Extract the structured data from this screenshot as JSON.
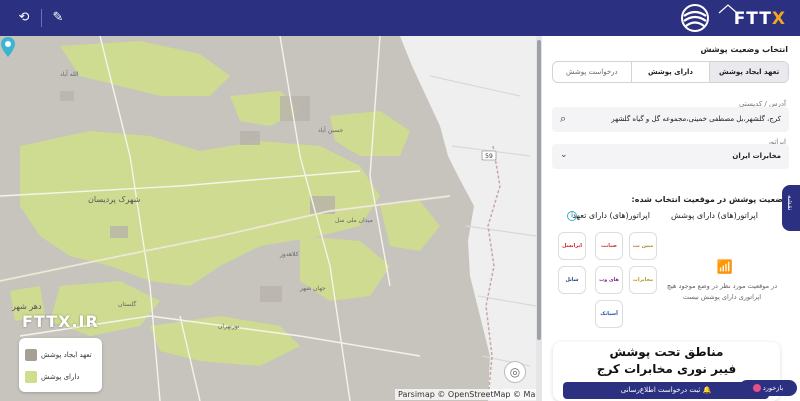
{
  "header": {
    "brand_main": "FTT",
    "brand_x": "X",
    "tool_reset_icon": "refresh-cog-icon",
    "tool_edit_icon": "edit-square-icon"
  },
  "map": {
    "attribution": "Parsimap © OpenStreetMap © Mapbox ©",
    "watermark": "FTTX.IR",
    "legend": [
      {
        "label": "تعهد ایجاد پوشش",
        "color": "#a69f94"
      },
      {
        "label": "دارای پوشش",
        "color": "#cfdd8e"
      }
    ],
    "labels": {
      "city1": "شهرک پردیسان",
      "city2": "دهر شهر",
      "road": "گلستان",
      "road2": "جسین آباد",
      "road3": "کلاهدوز",
      "road4": "نورنهران",
      "road5": "میدان ملی سل",
      "road6": "الله آباد",
      "road7": "جهان شهر",
      "highway": "59"
    }
  },
  "panel": {
    "title": "انتخاب وضعیت پوشش",
    "tabs": [
      {
        "label": "تعهد ایجاد پوشش"
      },
      {
        "label": "دارای پوشش"
      },
      {
        "label": "درخواست پوشش"
      }
    ],
    "address_label": "آدرس / کدپستی",
    "address_value": "کرج، گلشهر،بل مصطفی خمینی،مجموعه گل و گیاه گلشهر",
    "operator_label": "اپراتور",
    "operator_value": "مخابرات ایران",
    "status_title": "وضعیت پوشش در موقعیت انتخاب شده:",
    "col_covered": "اپراتور(های) دارای پوشش",
    "col_commit": "اپراتور(های) دارای تعهد",
    "no_coverage": "در موقعیت مورد نظر در وضع موجود هیچ اپراتوری دارای پوشش نیست",
    "operators": [
      {
        "name": "مبین نت",
        "color": "#b38a2e"
      },
      {
        "name": "صبانت",
        "color": "#c93a3a"
      },
      {
        "name": "ایرانسل",
        "color": "#d11f2f"
      },
      {
        "name": "شاتل",
        "color": "#1e3e7a"
      },
      {
        "name": "های وب",
        "color": "#7a2a8a"
      },
      {
        "name": "مخابرات",
        "color": "#b59a1e"
      },
      {
        "name": "آسیاتک",
        "color": "#1f4f9a"
      }
    ],
    "side_tab": "نقشه"
  },
  "promo": {
    "line1": "مناطق تحت پوشش",
    "line2": "فیبر نوری مخابرات کرج",
    "button": "ثبت درخواست اطلاع‌رسانی"
  },
  "feedback": "بازخورد"
}
